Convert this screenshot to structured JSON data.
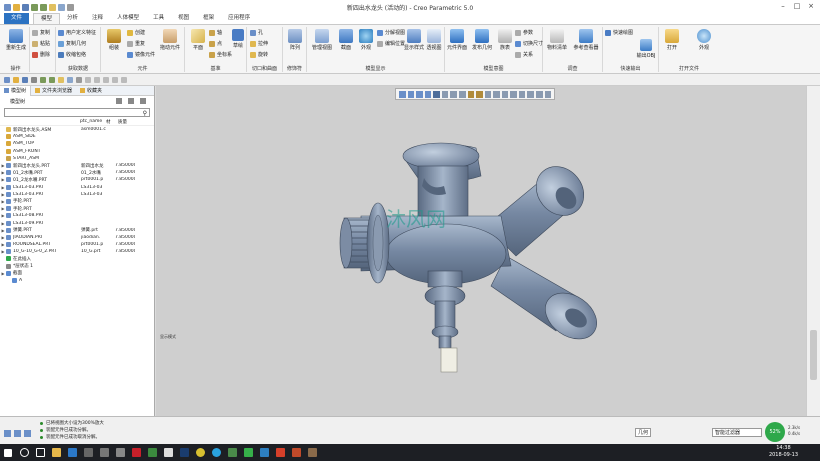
{
  "window": {
    "title": "新四出水龙头 (活动的) - Creo Parametric 5.0"
  },
  "tabs": [
    {
      "label": "文件"
    },
    {
      "label": "模型"
    },
    {
      "label": "分析"
    },
    {
      "label": "注释"
    },
    {
      "label": "人体模型"
    },
    {
      "label": "工具"
    },
    {
      "label": "视图"
    },
    {
      "label": "框架"
    },
    {
      "label": "应用程序"
    }
  ],
  "ribbon": {
    "groups": [
      {
        "label": "操作"
      },
      {
        "label": "获取数据"
      },
      {
        "label": "元件"
      },
      {
        "label": "基准"
      },
      {
        "label": "切口和曲面"
      },
      {
        "label": "修饰符"
      },
      {
        "label": "模型显示"
      },
      {
        "label": "模型意图"
      },
      {
        "label": "调查"
      },
      {
        "label": "快速输出"
      },
      {
        "label": "打开文件"
      }
    ],
    "commands": {
      "regenerate": "重新生成",
      "copy": "复制",
      "paste": "粘贴",
      "delete": "删除",
      "ufeature": "用户定义特征",
      "copy_geom": "复制几何",
      "shrinkwrap": "收缩包络",
      "assemble": "组装",
      "create": "创建",
      "repeat": "重复",
      "mirror_comp": "镜像元件",
      "drag_comp": "拖动元件",
      "plane": "平面",
      "axis": "轴",
      "point": "点",
      "csys": "坐标系",
      "sketch": "草绘",
      "hole": "孔",
      "extrude": "拉伸",
      "revolve": "旋转",
      "pattern": "阵列",
      "manage_view": "管理视图",
      "section": "截面",
      "appearance": "外观",
      "exploded_view": "分解视图",
      "edit_position": "编辑位置",
      "display_style": "显示样式",
      "perspective": "透视图",
      "comp_interface": "元件界面",
      "publish_geom": "发布几何",
      "family_table": "族表",
      "params": "参数",
      "switch_size": "切换尺寸",
      "relations": "关系",
      "bom": "物料清单",
      "ref_viewer": "参考查看器",
      "quick_drawing": "快速绘图",
      "export_obj": "输出OBJ",
      "open": "打开",
      "ext": "外观"
    }
  },
  "panel": {
    "tabs": [
      "模型树",
      "文件夹浏览器",
      "收藏夹"
    ],
    "tree_label": "模型树",
    "columns": [
      "",
      "ptc_name",
      "材",
      "质量"
    ],
    "rows": [
      {
        "name": "新四出水龙头.ASM",
        "c2": "asm0001.c",
        "c3": "",
        "icon": "asm"
      },
      {
        "name": "ASM_SIDE",
        "c2": "",
        "c3": "",
        "icon": "plane"
      },
      {
        "name": "ASM_TOP",
        "c2": "",
        "c3": "",
        "icon": "plane"
      },
      {
        "name": "ASM_FRONT",
        "c2": "",
        "c3": "",
        "icon": "plane"
      },
      {
        "name": "START_ASM",
        "c2": "",
        "c3": "",
        "icon": "csys"
      },
      {
        "name": "新四出水龙头.PRT",
        "c2": "新四出水龙",
        "c3": "7.850000",
        "icon": "part"
      },
      {
        "name": "01_2水嘴.PRT",
        "c2": "01_2水嘴",
        "c3": "7.850000",
        "icon": "part"
      },
      {
        "name": "01_2龙水嘴.PRT",
        "c2": "prt0001.p",
        "c3": "7.850000",
        "icon": "part"
      },
      {
        "name": "LS313-03.PRT",
        "c2": "LS313-03",
        "c3": "",
        "icon": "part"
      },
      {
        "name": "LS313-03.PRT",
        "c2": "LS313-03",
        "c3": "",
        "icon": "part"
      },
      {
        "name": "手轮.PRT",
        "c2": "",
        "c3": "",
        "icon": "part"
      },
      {
        "name": "手轮.PRT",
        "c2": "",
        "c3": "",
        "icon": "part"
      },
      {
        "name": "LS313-08.PRT",
        "c2": "",
        "c3": "",
        "icon": "part"
      },
      {
        "name": "LS313-09.PRT",
        "c2": "",
        "c3": "",
        "icon": "part"
      },
      {
        "name": "弹簧.PRT",
        "c2": "弹簧.prt",
        "c3": "7.850000",
        "icon": "part"
      },
      {
        "name": "JIAODIAN.PRT",
        "c2": "jiaodian.",
        "c3": "7.850000",
        "icon": "part"
      },
      {
        "name": "ROUNDSEAL.PRT",
        "c2": "prt0001.p",
        "c3": "7.850000",
        "icon": "part"
      },
      {
        "name": "10_G-10_G-0_2.PRT",
        "c2": "10_G.prt",
        "c3": "7.850000",
        "icon": "part"
      },
      {
        "name": "在此插入",
        "c2": "",
        "c3": "",
        "icon": "insert"
      },
      {
        "name": "*层状态 1",
        "c2": "",
        "c3": "",
        "icon": "layer"
      },
      {
        "name": "截面",
        "c2": "",
        "c3": "",
        "icon": "section"
      },
      {
        "name": "A",
        "c2": "",
        "c3": "",
        "icon": "sub"
      }
    ]
  },
  "viewport": {
    "corner_label": "显示模式",
    "watermark": "沐风网"
  },
  "status": {
    "messages": [
      "已将视图大小设为300%放大",
      "装配元件已成功分解。",
      "装配元件已成功取消分解。"
    ],
    "filter": "智能过滤器",
    "selector": "几何",
    "progress_pct": "52%",
    "speed_up": "2.3k/s",
    "speed_down": "0.4k/s"
  },
  "taskbar": {
    "time": "14:38",
    "date": "2018-09-13"
  }
}
